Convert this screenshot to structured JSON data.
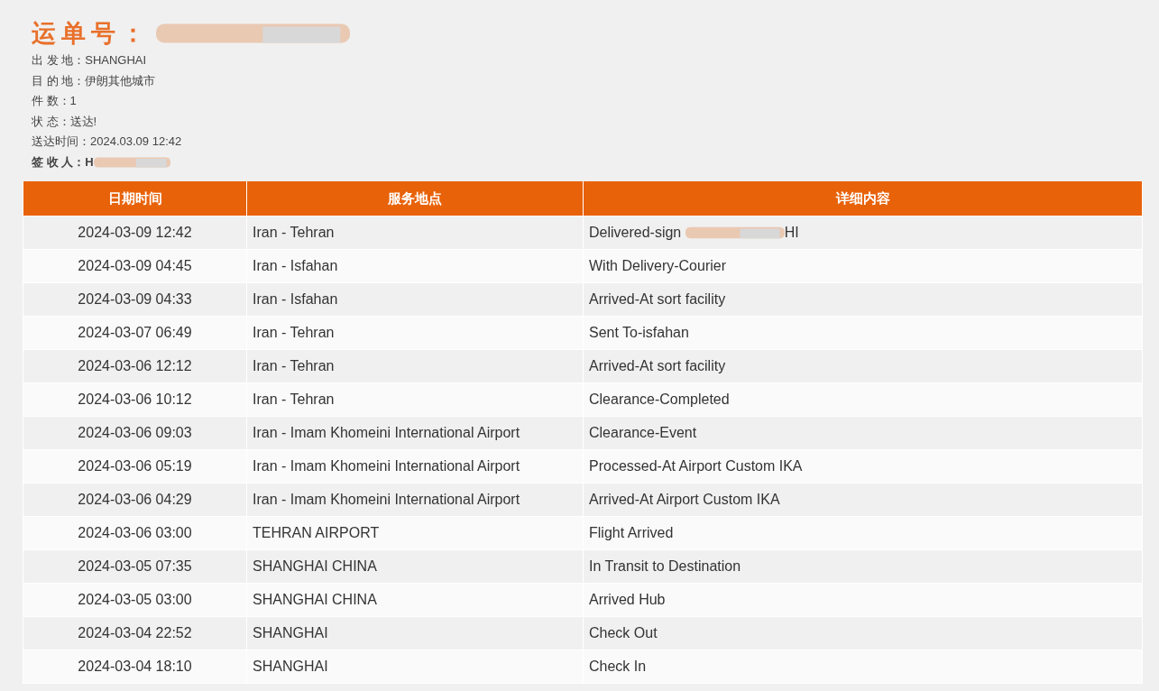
{
  "waybill": {
    "label": "运单号："
  },
  "info": [
    {
      "text": "出 发 地：SHANGHAI",
      "bold": false,
      "redacted": false
    },
    {
      "text": "目 的 地：伊朗其他城市",
      "bold": false,
      "redacted": false
    },
    {
      "text": "件 数：1",
      "bold": false,
      "redacted": false
    },
    {
      "text": "状 态：送达!",
      "bold": false,
      "redacted": false
    },
    {
      "text": "送达时间：2024.03.09 12:42",
      "bold": false,
      "redacted": false
    },
    {
      "text": "签 收 人：H",
      "bold": true,
      "redacted": true
    }
  ],
  "table": {
    "columns": [
      "日期时间",
      "服务地点",
      "详细内容"
    ],
    "rows": [
      {
        "time": "2024-03-09 12:42",
        "place": "Iran - Tehran",
        "detail": "Delivered-sign",
        "redacted_tail": "HI"
      },
      {
        "time": "2024-03-09 04:45",
        "place": "Iran - Isfahan",
        "detail": "With Delivery-Courier"
      },
      {
        "time": "2024-03-09 04:33",
        "place": "Iran - Isfahan",
        "detail": "Arrived-At sort facility"
      },
      {
        "time": "2024-03-07 06:49",
        "place": "Iran - Tehran",
        "detail": "Sent To-isfahan"
      },
      {
        "time": "2024-03-06 12:12",
        "place": "Iran - Tehran",
        "detail": "Arrived-At sort facility"
      },
      {
        "time": "2024-03-06 10:12",
        "place": "Iran - Tehran",
        "detail": "Clearance-Completed"
      },
      {
        "time": "2024-03-06 09:03",
        "place": "Iran - Imam Khomeini International Airport",
        "detail": "Clearance-Event"
      },
      {
        "time": "2024-03-06 05:19",
        "place": "Iran - Imam Khomeini International Airport",
        "detail": "Processed-At Airport Custom IKA"
      },
      {
        "time": "2024-03-06 04:29",
        "place": "Iran - Imam Khomeini International Airport",
        "detail": "Arrived-At Airport Custom IKA"
      },
      {
        "time": "2024-03-06 03:00",
        "place": "TEHRAN AIRPORT",
        "detail": "Flight Arrived"
      },
      {
        "time": "2024-03-05 07:35",
        "place": "SHANGHAI CHINA",
        "detail": "In Transit to Destination"
      },
      {
        "time": "2024-03-05 03:00",
        "place": "SHANGHAI CHINA",
        "detail": "Arrived Hub"
      },
      {
        "time": "2024-03-04 22:52",
        "place": "SHANGHAI",
        "detail": "Check Out"
      },
      {
        "time": "2024-03-04 18:10",
        "place": "SHANGHAI",
        "detail": "Check In"
      }
    ]
  }
}
